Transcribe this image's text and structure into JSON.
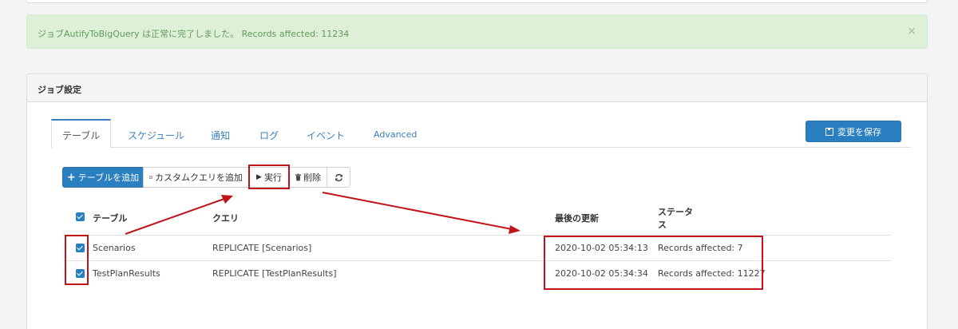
{
  "alert": {
    "message": "ジョブAutifyToBigQuery は正常に完了しました。 Records affected: 11234",
    "close": "×"
  },
  "panel": {
    "title": "ジョブ設定"
  },
  "tabs": [
    {
      "label": "テーブル",
      "active": true
    },
    {
      "label": "スケジュール"
    },
    {
      "label": "通知"
    },
    {
      "label": "ログ"
    },
    {
      "label": "イベント"
    },
    {
      "label": "Advanced"
    }
  ],
  "save_button": {
    "label": "変更を保存"
  },
  "toolbar": {
    "add_table": "テーブルを追加",
    "add_custom_query": "カスタムクエリを追加",
    "run": "実行",
    "delete": "削除"
  },
  "table": {
    "headers": {
      "table": "テーブル",
      "query": "クエリ",
      "last_updated": "最後の更新",
      "status_line1": "ステータ",
      "status_line2": "ス"
    },
    "rows": [
      {
        "table": "Scenarios",
        "query": "REPLICATE [Scenarios]",
        "last_updated": "2020-10-02 05:34:13",
        "status": "Records affected: 7",
        "checked": true
      },
      {
        "table": "TestPlanResults",
        "query": "REPLICATE [TestPlanResults]",
        "last_updated": "2020-10-02 05:34:34",
        "status": "Records affected: 11227",
        "checked": true
      }
    ]
  },
  "icons": {
    "plus": "plus-icon",
    "edit": "edit-icon",
    "play": "play-icon",
    "trash": "trash-icon",
    "refresh": "refresh-icon",
    "save": "save-icon",
    "check": "checkbox-checked-icon"
  },
  "colors": {
    "primary": "#2a7fc1",
    "alert_bg": "#dff0d8",
    "alert_text": "#5e9b58",
    "annotation": "#c0141b"
  }
}
